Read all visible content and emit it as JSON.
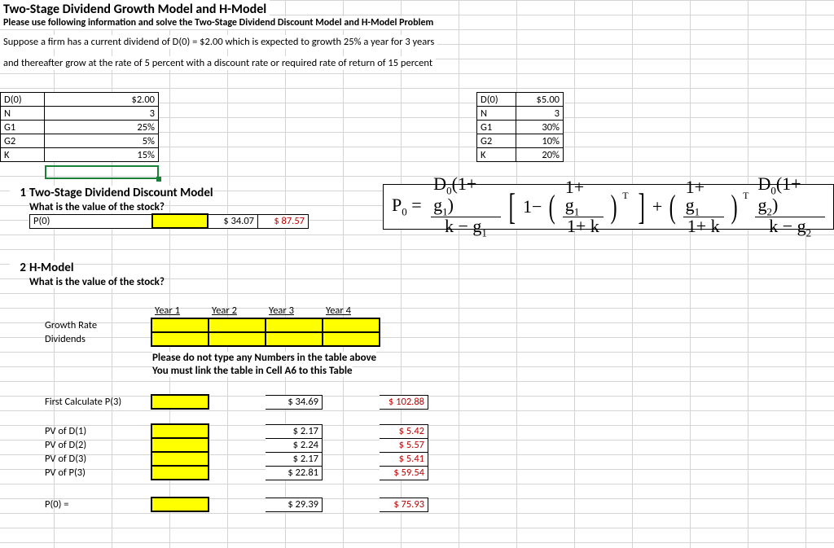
{
  "header": "Two-Stage Dividend Growth Model and H-Model",
  "subheader": "Please use following information and solve the Two-Stage Dividend Discount Model and H-Model Problem",
  "line1": "Suppose a firm has a current dividend of D(0) = $2.00 which is expected to growth 25% a year for 3 years",
  "line2": "and thereafter grow at the rate of 5 percent with a discount rate or required rate of return of 15 percent",
  "inputsA": {
    "D0": {
      "label": "D(0)",
      "value": "$2.00"
    },
    "N": {
      "label": "N",
      "value": "3"
    },
    "G1": {
      "label": "G1",
      "value": "25%"
    },
    "G2": {
      "label": "G2",
      "value": "5%"
    },
    "K": {
      "label": "K",
      "value": "15%"
    }
  },
  "inputsB": {
    "D0": {
      "label": "D(0)",
      "value": "$5.00"
    },
    "N": {
      "label": "N",
      "value": "3"
    },
    "G1": {
      "label": "G1",
      "value": "30%"
    },
    "G2": {
      "label": "G2",
      "value": "10%"
    },
    "K": {
      "label": "K",
      "value": "20%"
    }
  },
  "section1": {
    "num": "1",
    "title": "Two-Stage Dividend Discount Model",
    "q": "What is the value of the stock?",
    "P0label": "P(0)",
    "val1": "$  34.07",
    "val2": "$   87.57"
  },
  "section2": {
    "num": "2",
    "title": "H-Model",
    "q": "What is the value of the stock?",
    "years": [
      "Year 1",
      "Year 2",
      "Year 3",
      "Year 4"
    ],
    "rows": [
      "Growth Rate",
      "Dividends"
    ],
    "note1": "Please do not type any Numbers in the table above",
    "note2": "You must link the table in Cell A6 to this Table",
    "fcp3": "First Calculate P(3)",
    "fcp3v1": "$   34.69",
    "fcp3v2": "$ 102.88",
    "pv": [
      {
        "l": "PV of D(1)",
        "a": "$     2.17",
        "b": "$     5.42"
      },
      {
        "l": "PV of D(2)",
        "a": "$     2.24",
        "b": "$     5.57"
      },
      {
        "l": "PV of D(3)",
        "a": "$     2.17",
        "b": "$     5.41"
      },
      {
        "l": "PV of P(3)",
        "a": "$   22.81",
        "b": "$   59.54"
      }
    ],
    "p0l": "P(0) =",
    "p0a": "$   29.39",
    "p0b": "$   75.93"
  }
}
